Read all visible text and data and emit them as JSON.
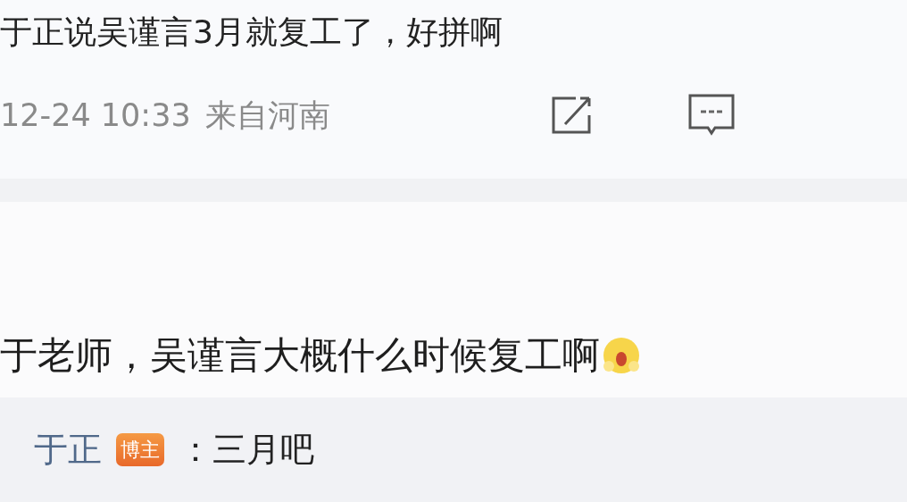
{
  "post": {
    "text": "于正说吴谨言3月就复工了，好拼啊",
    "time": "12-24 10:33",
    "source": "来自河南"
  },
  "comment": {
    "text": "于老师，吴谨言大概什么时候复工啊"
  },
  "reply": {
    "author": "于正",
    "badge": "博主",
    "text": "：三月吧"
  }
}
